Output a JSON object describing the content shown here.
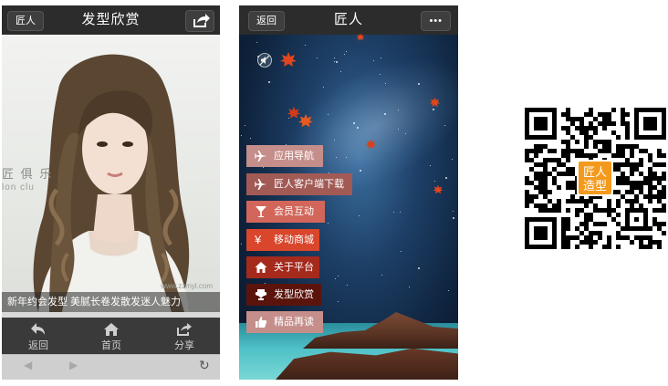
{
  "left_phone": {
    "header": {
      "back_label": "匠人",
      "title": "发型欣赏",
      "share_icon": "share-icon"
    },
    "photo": {
      "caption": "新年约会发型 美腻长卷发散发迷人魅力",
      "watermark_line1": "匠 俱 乐",
      "watermark_line2": "lon clu",
      "site_watermark": "www.zzmyl.com"
    },
    "bottom_nav": [
      {
        "label": "返回",
        "icon": "reply-icon"
      },
      {
        "label": "首页",
        "icon": "home-icon"
      },
      {
        "label": "分享",
        "icon": "share-icon"
      }
    ],
    "browser_bar": {
      "back": "◀",
      "forward": "▶",
      "refresh": "↻"
    }
  },
  "right_phone": {
    "header": {
      "back_label": "返回",
      "title": "匠人",
      "more": "•••"
    },
    "menu": [
      {
        "label": "应用导航",
        "icon": "airplane-icon",
        "color": "#c58e8a"
      },
      {
        "label": "匠人客户端下载",
        "icon": "airplane-icon",
        "color": "#a25a55"
      },
      {
        "label": "会员互动",
        "icon": "cocktail-icon",
        "color": "#d2665a"
      },
      {
        "label": "移动商城",
        "icon": "yen-icon",
        "color": "#d9462c"
      },
      {
        "label": "关于平台",
        "icon": "home-icon",
        "color": "#a52a1c"
      },
      {
        "label": "发型欣赏",
        "icon": "trophy-icon",
        "color": "#5a140c"
      },
      {
        "label": "精品再读",
        "icon": "thumbs-up-icon",
        "color": "#c58e8a"
      }
    ]
  },
  "qr": {
    "badge_line1": "匠人",
    "badge_line2": "造型"
  }
}
